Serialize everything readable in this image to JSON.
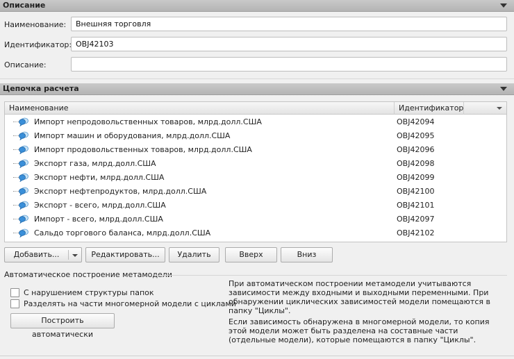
{
  "description_section": {
    "title": "Описание",
    "fields": [
      {
        "label": "Наименование:",
        "value": "Внешняя торговля"
      },
      {
        "label": "Идентификатор:",
        "value": "OBJ42103"
      },
      {
        "label": "Описание:",
        "value": ""
      }
    ]
  },
  "chain_section": {
    "title": "Цепочка расчета",
    "columns": [
      "Наименование",
      "Идентификатор"
    ],
    "rows": [
      {
        "name": "Импорт непродовольственных товаров, млрд.долл.США",
        "id": "OBJ42094"
      },
      {
        "name": "Импорт машин и оборудования, млрд.долл.США",
        "id": "OBJ42095"
      },
      {
        "name": "Импорт продовольственных товаров, млрд.долл.США",
        "id": "OBJ42096"
      },
      {
        "name": "Экспорт газа, млрд.долл.США",
        "id": "OBJ42098"
      },
      {
        "name": "Экспорт нефти, млрд.долл.США",
        "id": "OBJ42099"
      },
      {
        "name": "Экспорт нефтепродуктов, млрд.долл.США",
        "id": "OBJ42100"
      },
      {
        "name": "Экспорт - всего, млрд.долл.США",
        "id": "OBJ42101"
      },
      {
        "name": "Импорт - всего, млрд.долл.США",
        "id": "OBJ42097"
      },
      {
        "name": "Сальдо торгового баланса, млрд.долл.США",
        "id": "OBJ42102"
      }
    ],
    "row_icon": "model-chat-icon",
    "buttons": {
      "add": "Добавить...",
      "edit": "Редактировать...",
      "delete": "Удалить",
      "up": "Вверх",
      "down": "Вниз"
    }
  },
  "auto_build": {
    "title": "Автоматическое построение метамодели",
    "checkbox1": "С нарушением структуры папок",
    "checkbox2": "Разделять на части многомерной модели с циклами",
    "build_button": "Построить автоматически",
    "info1": "При автоматическом построении метамодели учитываются зависимости между входными и выходными переменными. При обнаружении циклических зависимостей модели помещаются в папку \"Циклы\".",
    "info2": "Если зависимость обнаружена в многомерной модели, то копия этой модели может быть разделена на составные части (отдельные модели), которые помещаются в папку \"Циклы\"."
  },
  "colors": {
    "header_bg": "#bdbdbd",
    "icon_blue": "#3a8fd9"
  }
}
